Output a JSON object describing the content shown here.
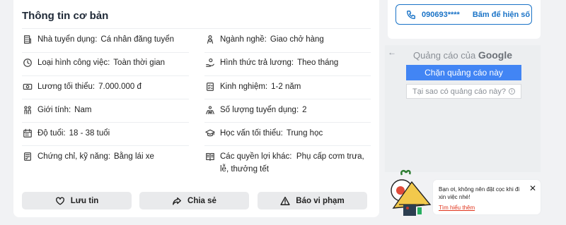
{
  "card": {
    "title": "Thông tin cơ bản",
    "rows": [
      {
        "label": "Nhà tuyển dụng:",
        "value": "Cá nhân đăng tuyển",
        "icon": "building-icon"
      },
      {
        "label": "Ngành nghề:",
        "value": "Giao chở hàng",
        "icon": "person-icon"
      },
      {
        "label": "Loại hình công việc:",
        "value": "Toàn thời gian",
        "icon": "clock-icon"
      },
      {
        "label": "Hình thức trả lương:",
        "value": "Theo tháng",
        "icon": "hand-money-icon"
      },
      {
        "label": "Lương tối thiểu:",
        "value": "7.000.000 đ",
        "icon": "banknote-icon"
      },
      {
        "label": "Kinh nghiệm:",
        "value": "1-2 năm",
        "icon": "checklist-icon"
      },
      {
        "label": "Giới tính:",
        "value": "Nam",
        "icon": "gender-icon"
      },
      {
        "label": "Số lượng tuyển dụng:",
        "value": "2",
        "icon": "group-icon"
      },
      {
        "label": "Độ tuổi:",
        "value": "18 - 38 tuổi",
        "icon": "calendar-icon"
      },
      {
        "label": "Học vấn tối thiểu:",
        "value": "Trung học",
        "icon": "graduation-cap-icon"
      },
      {
        "label": "Chứng chỉ, kỹ năng:",
        "value": "Bằng lái xe",
        "icon": "certificate-icon"
      },
      {
        "label": "Các quyền lợi khác:",
        "value": "Phụ cấp cơm trưa, lễ, thưởng tết",
        "icon": "book-icon"
      }
    ],
    "buttons": {
      "save": "Lưu tin",
      "share": "Chia sẻ",
      "report": "Báo vi phạm"
    }
  },
  "phone": {
    "number": "090693****",
    "reveal": "Bấm để hiện số"
  },
  "ad": {
    "back": "←",
    "header_prefix": "Quảng cáo của",
    "header_brand": "Google",
    "block": "Chặn quảng cáo này",
    "why": "Tại sao có quảng cáo này?",
    "why_icon": "i"
  },
  "warning": {
    "text": "Bạn ơi, không nên đặt cọc khi đi xin việc nhé!",
    "link": "Tìm hiểu thêm",
    "close": "✕"
  }
}
